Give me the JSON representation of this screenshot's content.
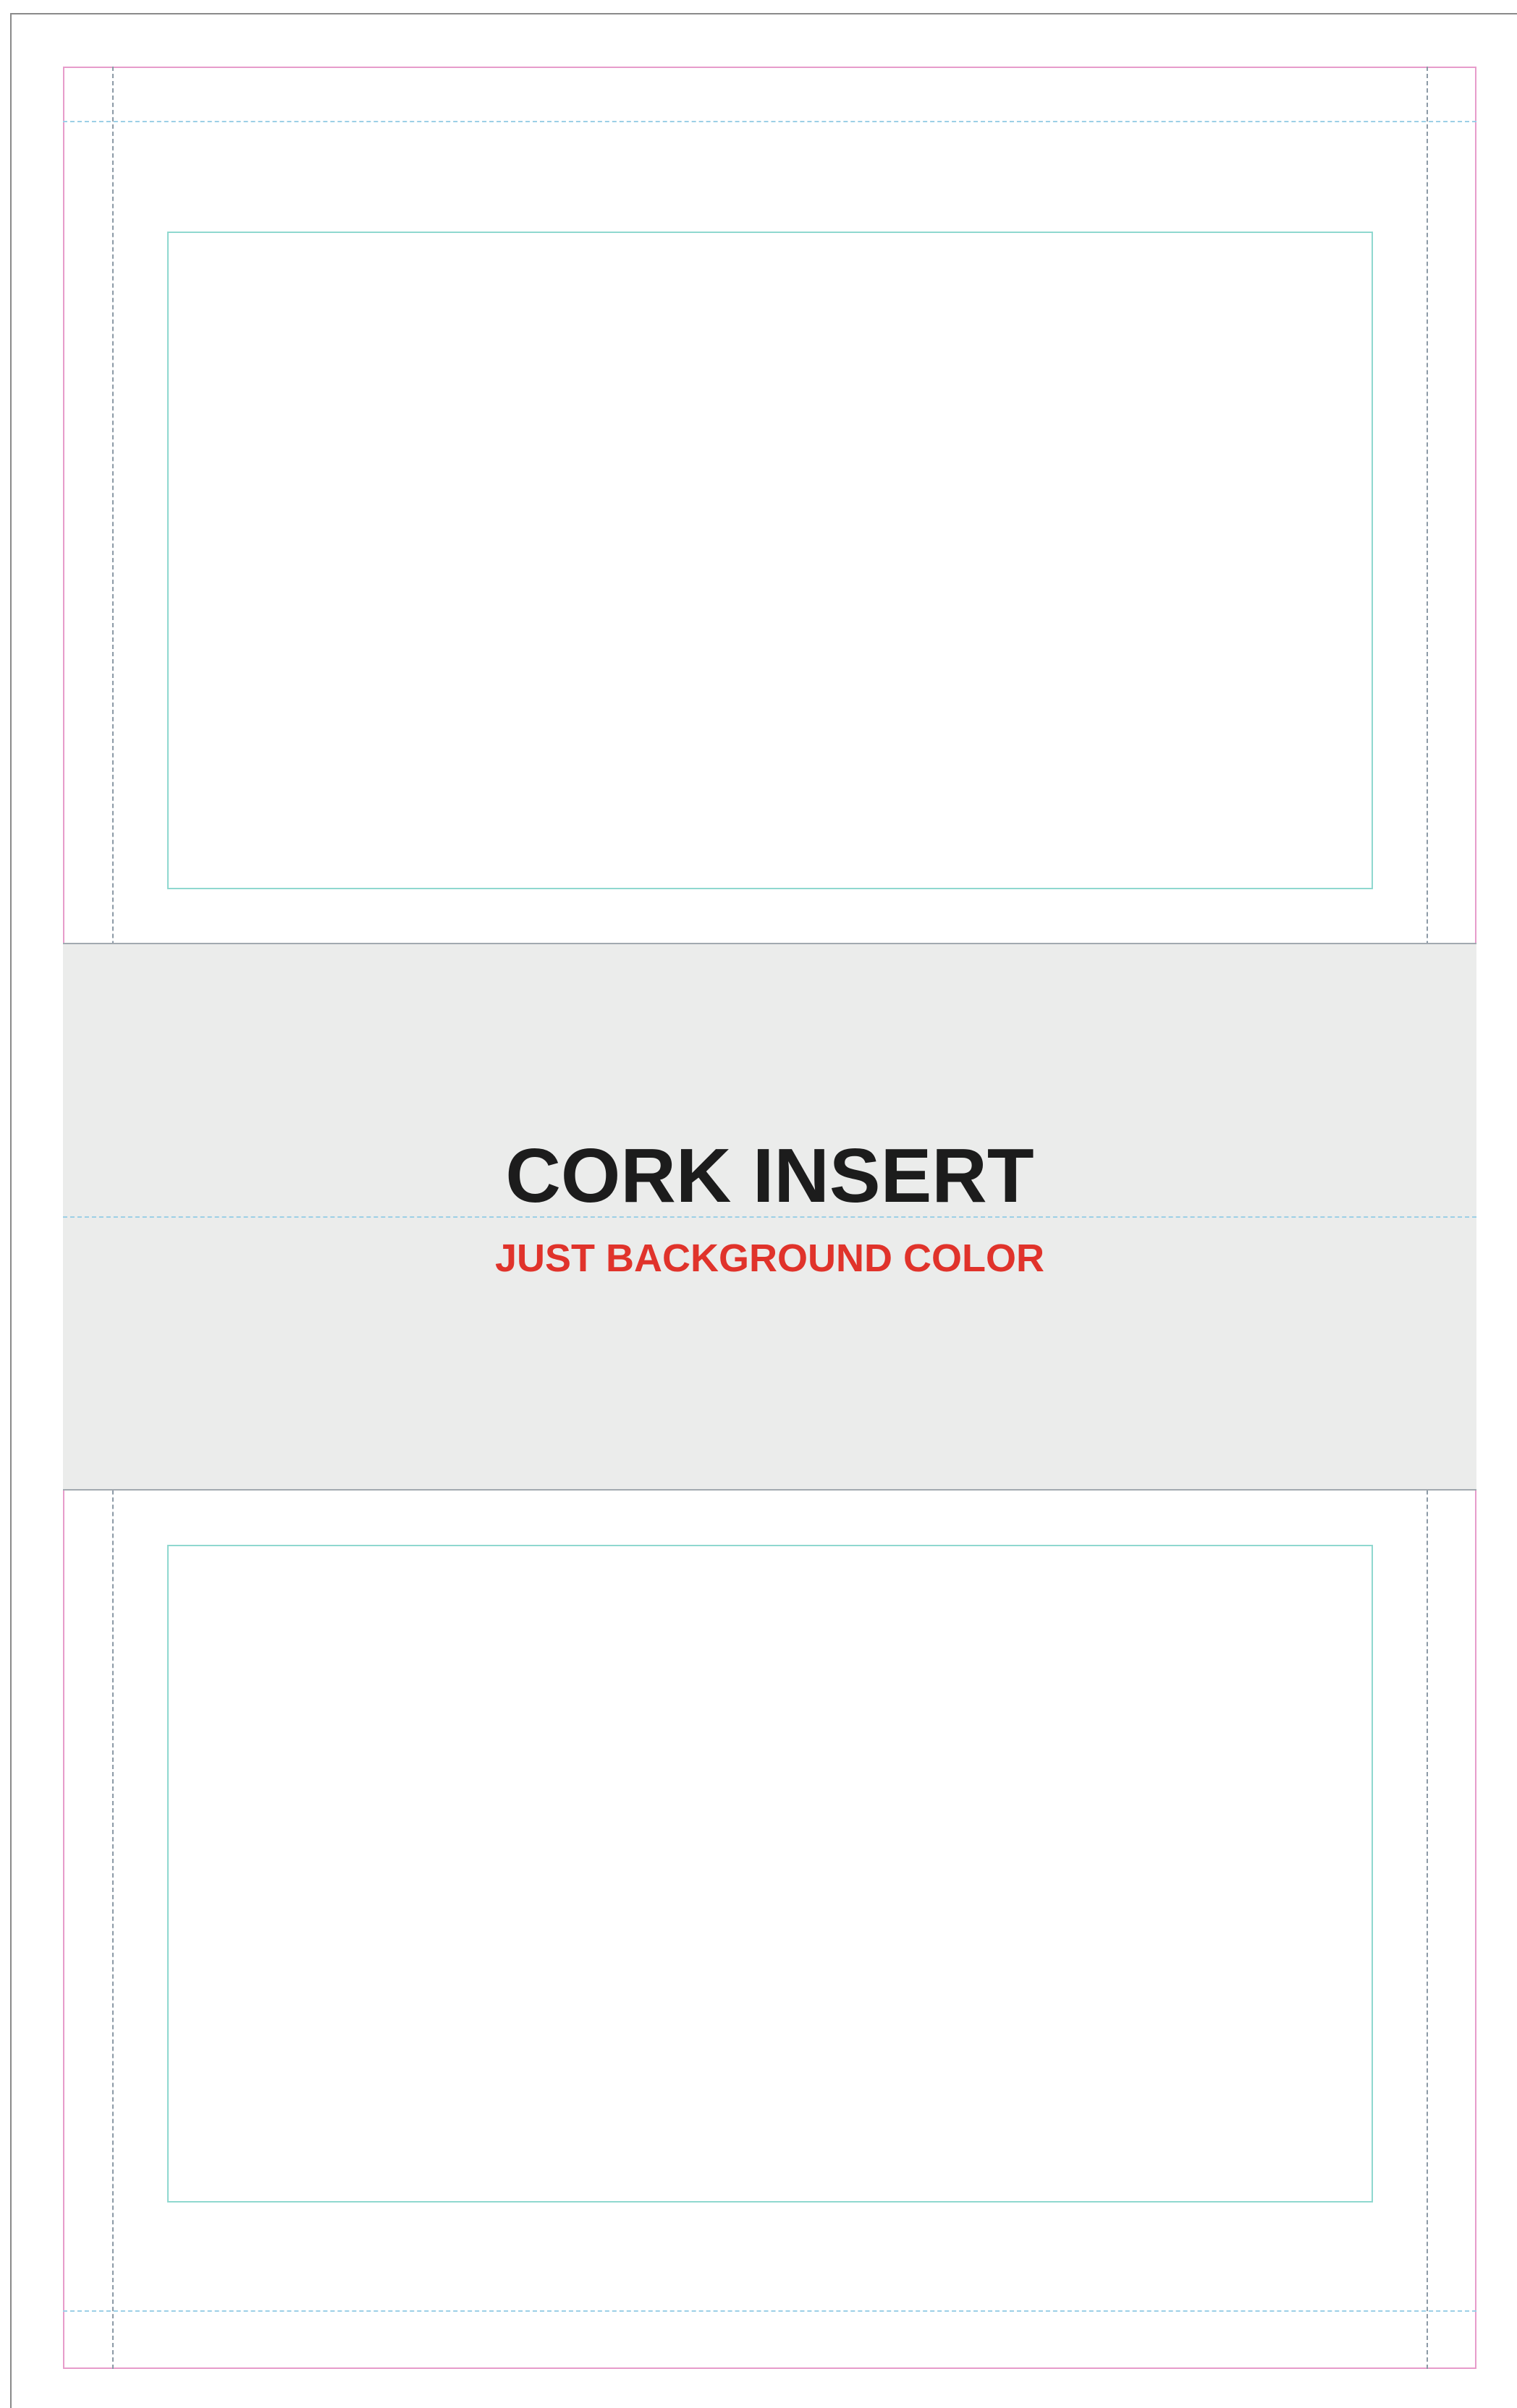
{
  "cork_insert": {
    "title": "CORK INSERT",
    "subtitle": "JUST BACKGROUND COLOR"
  },
  "colors": {
    "title": "#1c1c1c",
    "subtitle": "#e0332b",
    "band_fill": "#ebeceb",
    "bleed_line": "#e79ccb",
    "frame_line": "#8fd8cf"
  }
}
